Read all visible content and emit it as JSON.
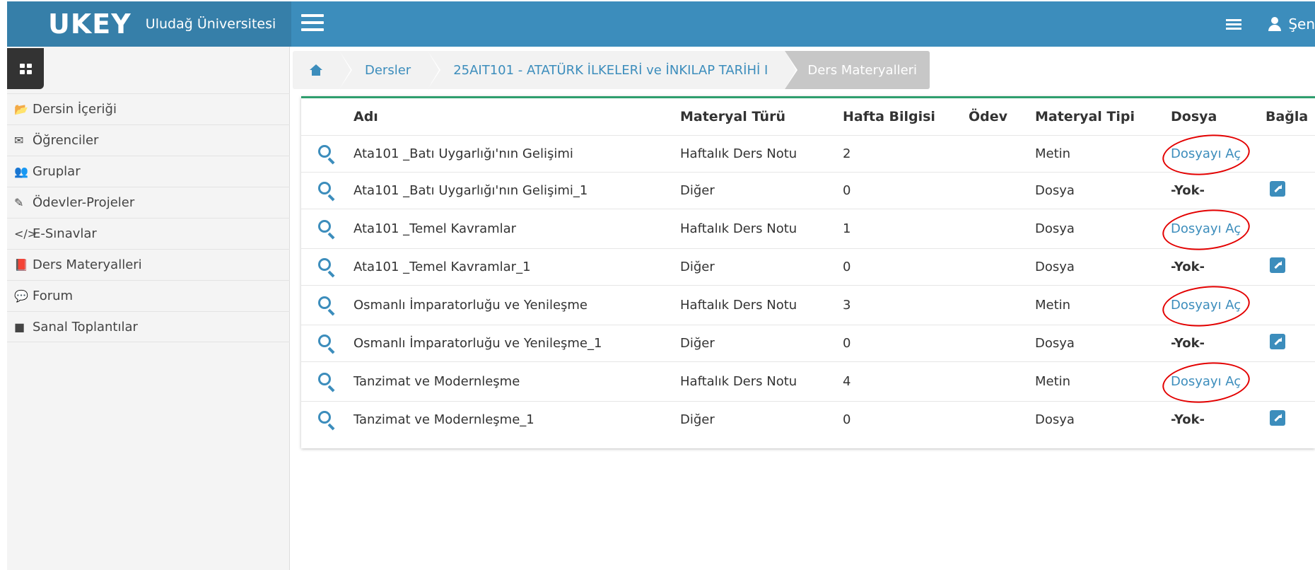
{
  "header": {
    "logo": "UKEY",
    "university": "Uludağ Üniversitesi",
    "user_name": "Şen"
  },
  "sidebar": {
    "items": [
      {
        "label": "Dersin İçeriği",
        "icon": "📂"
      },
      {
        "label": "Öğrenciler",
        "icon": "✉"
      },
      {
        "label": "Gruplar",
        "icon": "👥"
      },
      {
        "label": "Ödevler-Projeler",
        "icon": "✎"
      },
      {
        "label": "E-Sınavlar",
        "icon": "</>"
      },
      {
        "label": "Ders Materyalleri",
        "icon": "📕"
      },
      {
        "label": "Forum",
        "icon": "💬"
      },
      {
        "label": "Sanal Toplantılar",
        "icon": "■"
      }
    ]
  },
  "breadcrumb": {
    "home_icon": "home-icon",
    "dersler": "Dersler",
    "course": "25AIT101 - ATATÜRK İLKELERİ ve İNKILAP TARİHİ I",
    "current": "Ders Materyalleri"
  },
  "table": {
    "headers": {
      "name": "Adı",
      "type": "Materyal Türü",
      "week": "Hafta Bilgisi",
      "homework": "Ödev",
      "kind": "Materyal Tipi",
      "file": "Dosya",
      "link": "Bağla"
    },
    "rows": [
      {
        "name": "Ata101 _Batı Uygarlığı'nın Gelişimi",
        "type": "Haftalık Ders Notu",
        "week": "2",
        "kind": "Metin",
        "file": "Dosyayı Aç"
      },
      {
        "name": "Ata101 _Batı Uygarlığı'nın Gelişimi_1",
        "type": "Diğer",
        "week": "0",
        "kind": "Dosya",
        "file": "-Yok-"
      },
      {
        "name": "Ata101 _Temel Kavramlar",
        "type": "Haftalık Ders Notu",
        "week": "1",
        "kind": "Dosya",
        "file": "Dosyayı Aç"
      },
      {
        "name": "Ata101 _Temel Kavramlar_1",
        "type": "Diğer",
        "week": "0",
        "kind": "Dosya",
        "file": "-Yok-"
      },
      {
        "name": "Osmanlı İmparatorluğu ve Yenileşme",
        "type": "Haftalık Ders Notu",
        "week": "3",
        "kind": "Metin",
        "file": "Dosyayı Aç"
      },
      {
        "name": "Osmanlı İmparatorluğu ve Yenileşme_1",
        "type": "Diğer",
        "week": "0",
        "kind": "Dosya",
        "file": "-Yok-"
      },
      {
        "name": "Tanzimat ve Modernleşme",
        "type": "Haftalık Ders Notu",
        "week": "4",
        "kind": "Metin",
        "file": "Dosyayı Aç"
      },
      {
        "name": "Tanzimat ve Modernleşme_1",
        "type": "Diğer",
        "week": "0",
        "kind": "Dosya",
        "file": "-Yok-"
      }
    ]
  },
  "colors": {
    "primary": "#3c8dbc",
    "primary_dark": "#367fa9",
    "panel_top_border": "#2e9e6e",
    "annotation_red": "#e30000"
  }
}
